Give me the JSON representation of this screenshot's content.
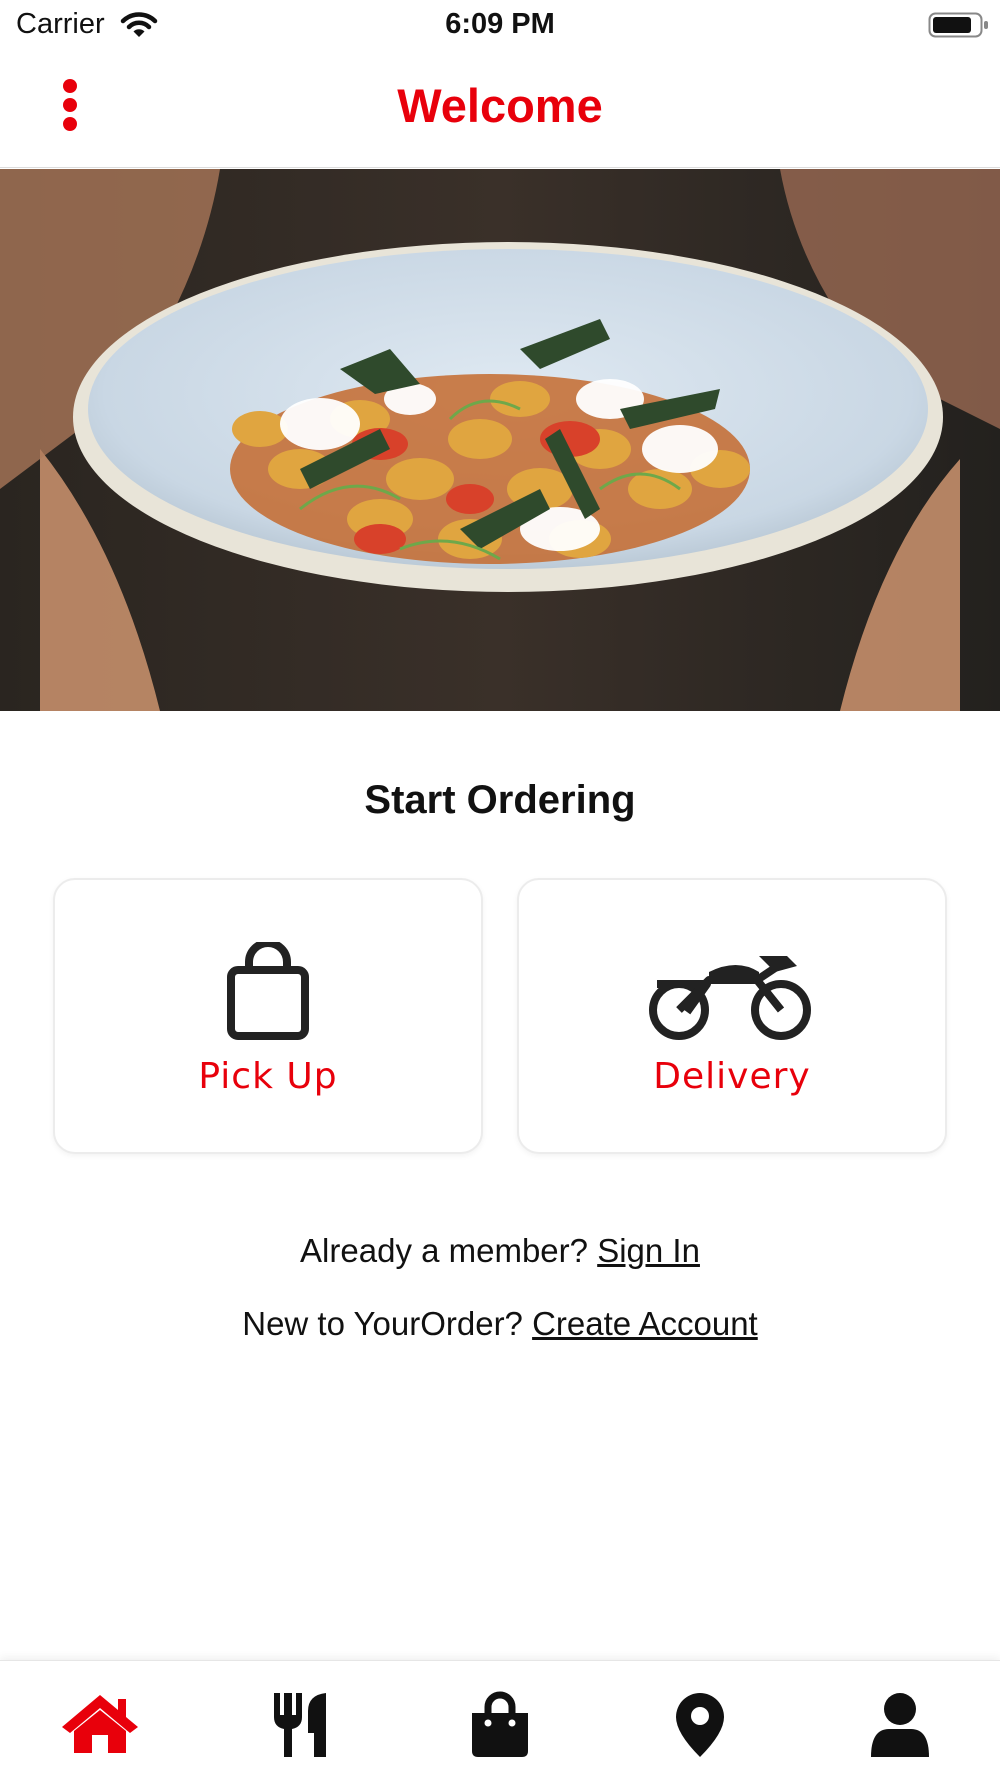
{
  "status_bar": {
    "carrier": "Carrier",
    "time": "6:09 PM"
  },
  "header": {
    "title": "Welcome",
    "menu_icon": "more-vertical-icon"
  },
  "colors": {
    "accent": "#e8000b",
    "text": "#111111",
    "card_border": "#ececec"
  },
  "hero": {
    "image": "gnocchi-dish-photo"
  },
  "ordering": {
    "title": "Start Ordering",
    "options": [
      {
        "label": "Pick Up",
        "icon": "shopping-bag-icon"
      },
      {
        "label": "Delivery",
        "icon": "motorbike-icon"
      }
    ]
  },
  "account": {
    "member_prompt": "Already a member?",
    "sign_in": "Sign In",
    "new_prompt": "New to YourOrder?",
    "create_account": "Create Account"
  },
  "tab_bar": {
    "active_tab": "home",
    "tabs": [
      {
        "id": "home",
        "icon": "home-icon"
      },
      {
        "id": "menu",
        "icon": "fork-knife-icon"
      },
      {
        "id": "bag",
        "icon": "shopping-bag-icon"
      },
      {
        "id": "locations",
        "icon": "map-pin-icon"
      },
      {
        "id": "account",
        "icon": "user-icon"
      }
    ]
  }
}
